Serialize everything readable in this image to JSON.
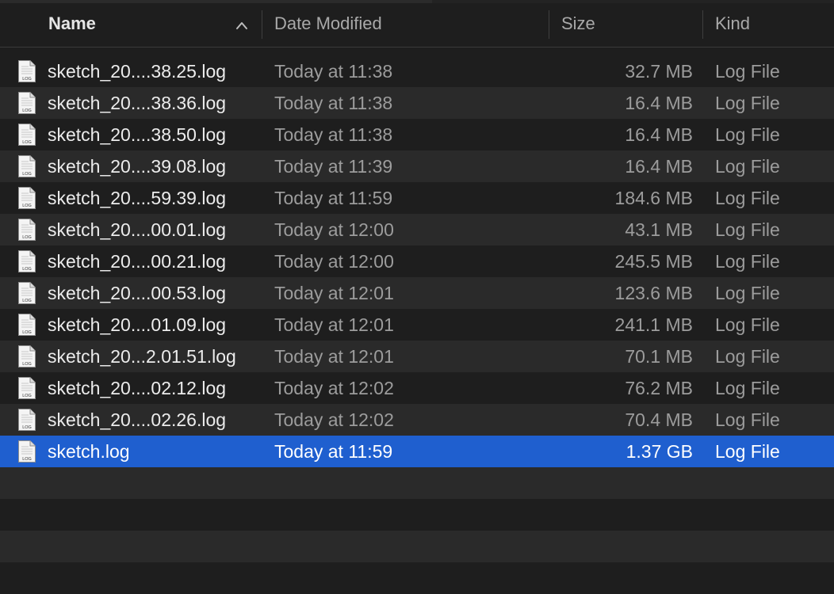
{
  "header": {
    "name_label": "Name",
    "date_label": "Date Modified",
    "size_label": "Size",
    "kind_label": "Kind",
    "sort_indicator": "chevron-up-icon"
  },
  "file_icon_badge": "LOG",
  "files": [
    {
      "name": "sketch_20....38.25.log",
      "date": "Today at 11:38",
      "size": "32.7 MB",
      "kind": "Log File"
    },
    {
      "name": "sketch_20....38.36.log",
      "date": "Today at 11:38",
      "size": "16.4 MB",
      "kind": "Log File"
    },
    {
      "name": "sketch_20....38.50.log",
      "date": "Today at 11:38",
      "size": "16.4 MB",
      "kind": "Log File"
    },
    {
      "name": "sketch_20....39.08.log",
      "date": "Today at 11:39",
      "size": "16.4 MB",
      "kind": "Log File"
    },
    {
      "name": "sketch_20....59.39.log",
      "date": "Today at 11:59",
      "size": "184.6 MB",
      "kind": "Log File"
    },
    {
      "name": "sketch_20....00.01.log",
      "date": "Today at 12:00",
      "size": "43.1 MB",
      "kind": "Log File"
    },
    {
      "name": "sketch_20....00.21.log",
      "date": "Today at 12:00",
      "size": "245.5 MB",
      "kind": "Log File"
    },
    {
      "name": "sketch_20....00.53.log",
      "date": "Today at 12:01",
      "size": "123.6 MB",
      "kind": "Log File"
    },
    {
      "name": "sketch_20....01.09.log",
      "date": "Today at 12:01",
      "size": "241.1 MB",
      "kind": "Log File"
    },
    {
      "name": "sketch_20...2.01.51.log",
      "date": "Today at 12:01",
      "size": "70.1 MB",
      "kind": "Log File"
    },
    {
      "name": "sketch_20....02.12.log",
      "date": "Today at 12:02",
      "size": "76.2 MB",
      "kind": "Log File"
    },
    {
      "name": "sketch_20....02.26.log",
      "date": "Today at 12:02",
      "size": "70.4 MB",
      "kind": "Log File"
    },
    {
      "name": "sketch.log",
      "date": "Today at 11:59",
      "size": "1.37 GB",
      "kind": "Log File",
      "selected": true
    }
  ],
  "colors": {
    "background": "#1e1e1e",
    "row_alt": "#2a2a2a",
    "selection": "#1f5fcf",
    "text_primary": "#ececec",
    "text_secondary": "#9c9c9c"
  }
}
